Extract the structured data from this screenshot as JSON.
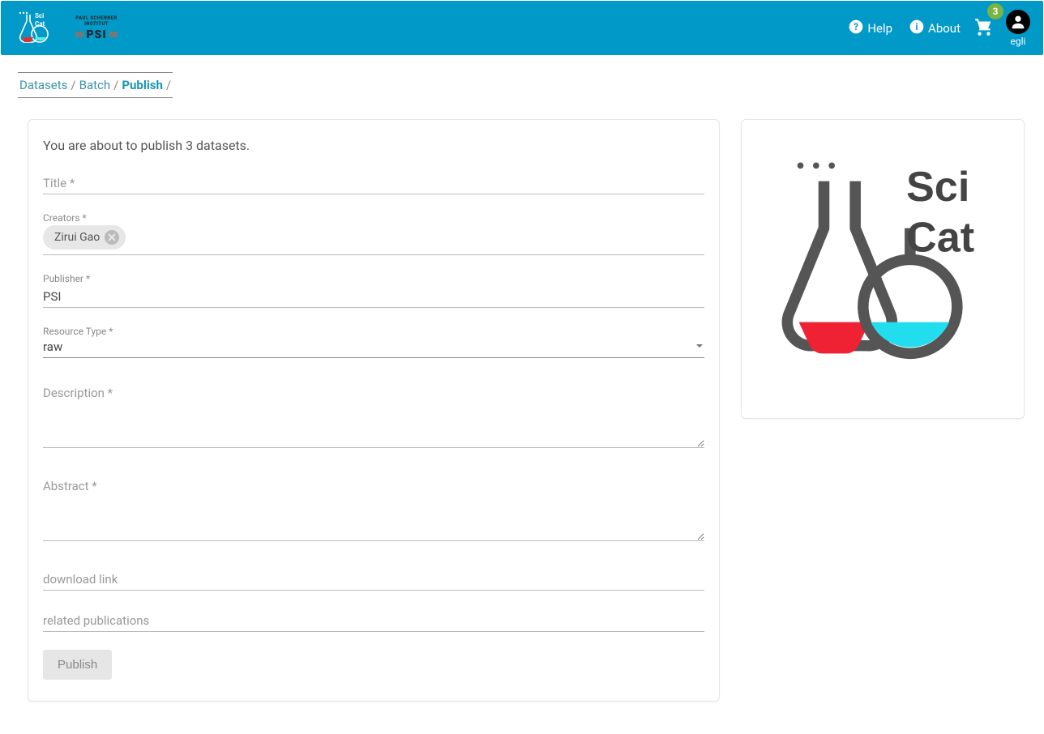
{
  "header": {
    "help_label": "Help",
    "about_label": "About",
    "cart_badge": "3",
    "username": "egli"
  },
  "breadcrumbs": {
    "items": [
      {
        "label": "Datasets",
        "current": false
      },
      {
        "label": "Batch",
        "current": false
      },
      {
        "label": "Publish",
        "current": true
      }
    ],
    "sep": "/"
  },
  "form": {
    "intro": "You are about to publish 3 datasets.",
    "title": {
      "label": "Title *",
      "value": ""
    },
    "creators": {
      "label": "Creators *",
      "chips": [
        "Zirui Gao"
      ]
    },
    "publisher": {
      "label": "Publisher *",
      "value": "PSI"
    },
    "resource_type": {
      "label": "Resource Type *",
      "value": "raw"
    },
    "description": {
      "label": "Description *",
      "value": ""
    },
    "abstract": {
      "label": "Abstract *",
      "value": ""
    },
    "download_link": {
      "label": "download link",
      "value": ""
    },
    "related_publications": {
      "label": "related publications",
      "value": ""
    },
    "publish_button": "Publish"
  },
  "logo_text": {
    "psi_caption": "PAUL SCHERRER INSTITUT",
    "psi_letters": "PSI"
  }
}
